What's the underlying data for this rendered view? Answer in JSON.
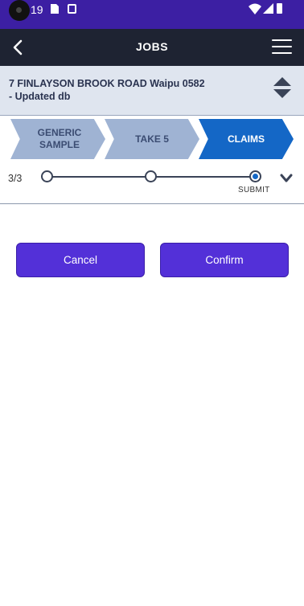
{
  "status_bar": {
    "time": "19"
  },
  "app_bar": {
    "title": "JOBS"
  },
  "job": {
    "address_line1": "7 FINLAYSON BROOK ROAD Waipu 0582",
    "address_line2": "- Updated db"
  },
  "steps": [
    {
      "label_line1": "GENERIC",
      "label_line2": "SAMPLE",
      "active": false
    },
    {
      "label_line1": "TAKE 5",
      "label_line2": "",
      "active": false
    },
    {
      "label_line1": "CLAIMS",
      "label_line2": "",
      "active": true
    }
  ],
  "progress": {
    "count": "3/3",
    "current_step_label": "SUBMIT",
    "current": 3,
    "total": 3
  },
  "actions": {
    "cancel_label": "Cancel",
    "confirm_label": "Confirm"
  },
  "colors": {
    "status_bar": "#3c1fa3",
    "app_bar": "#1e2332",
    "accent": "#5330d8",
    "active_step": "#1467c6",
    "inactive_step": "#9fb3d3"
  }
}
